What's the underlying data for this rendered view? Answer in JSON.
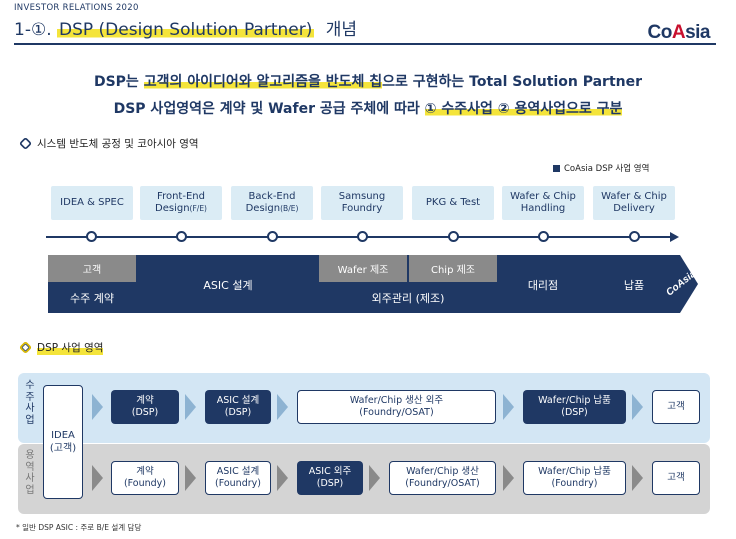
{
  "header": {
    "kicker": "INVESTOR  RELATIONS 2020",
    "number": "1-①.",
    "title_hl": "DSP (Design Solution Partner)",
    "title_tail": "개념",
    "logo_a": "Co",
    "logo_b": "A",
    "logo_c": "sia"
  },
  "headline": {
    "line1_a": "DSP는 ",
    "line1_hl": "고객의 아이디어와 알고리즘을 반도체 칩",
    "line1_b": "으로 구현하는 Total Solution Partner",
    "line2_a": "DSP 사업영역은 계약 및 Wafer 공급 주체에 따라 ",
    "line2_hl": "① 수주사업 ② 용역사업으로 구분"
  },
  "section1": {
    "title": "시스템 반도체 공정 및 코아시아 영역",
    "legend": "CoAsia DSP 사업 영역",
    "stages": [
      {
        "line1": "IDEA & SPEC",
        "line2": "",
        "sub": ""
      },
      {
        "line1": "Front-End",
        "line2": "Design",
        "sub": "(F/E)"
      },
      {
        "line1": "Back-End",
        "line2": "Design",
        "sub": "(B/E)"
      },
      {
        "line1": "Samsung",
        "line2": "Foundry",
        "sub": ""
      },
      {
        "line1": "PKG & Test",
        "line2": "",
        "sub": ""
      },
      {
        "line1": "Wafer & Chip",
        "line2": "Handling",
        "sub": ""
      },
      {
        "line1": "Wafer & Chip",
        "line2": "Delivery",
        "sub": ""
      }
    ],
    "band": {
      "customer": "고객",
      "order": "수주 계약",
      "asic": "ASIC 설계",
      "wafer_mfg": "Wafer 제조",
      "chip_mfg": "Chip 제조",
      "outsourcing": "외주관리 (제조)",
      "agency": "대리점",
      "delivery": "납품",
      "brand": "CoAsia"
    }
  },
  "section2": {
    "title": "DSP 사업 영역",
    "label_top": [
      "수",
      "주",
      "사",
      "업"
    ],
    "label_bottom": [
      "용",
      "역",
      "사",
      "업"
    ],
    "idea_line1": "IDEA",
    "idea_line2": "(고객)",
    "top_row": [
      {
        "line1": "계약",
        "line2": "(DSP)"
      },
      {
        "line1": "ASIC 설계",
        "line2": "(DSP)"
      },
      {
        "line1": "Wafer/Chip 생산 외주",
        "line2": "(Foundry/OSAT)"
      },
      {
        "line1": "Wafer/Chip 납품",
        "line2": "(DSP)"
      },
      {
        "line1": "고객",
        "line2": ""
      }
    ],
    "bottom_row": [
      {
        "line1": "계약",
        "line2": "(Foundy)"
      },
      {
        "line1": "ASIC 설계",
        "line2": "(Foundry)"
      },
      {
        "line1": "ASIC 외주",
        "line2": "(DSP)"
      },
      {
        "line1": "Wafer/Chip 생산",
        "line2": "(Foundry/OSAT)"
      },
      {
        "line1": "Wafer/Chip 납품",
        "line2": "(Foundry)"
      },
      {
        "line1": "고객",
        "line2": ""
      }
    ]
  },
  "footnote": "* 일반 DSP ASIC : 주로 B/E 설계 담당",
  "colors": {
    "navy": "#1f3864",
    "highlight": "#f4e43a",
    "light_blue": "#d3e6f4",
    "grey": "#8a8a8a"
  }
}
